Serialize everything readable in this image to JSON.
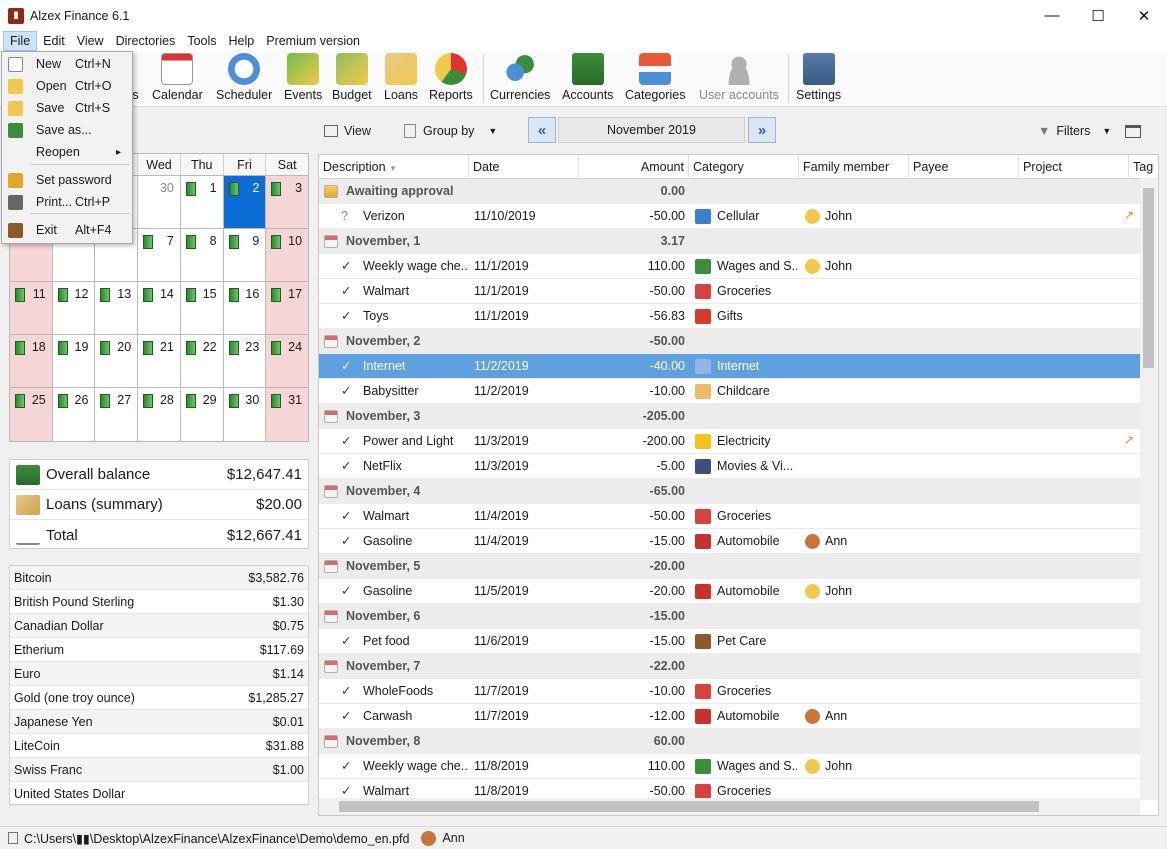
{
  "window": {
    "title": "Alzex Finance 6.1",
    "minimize": "—",
    "maximize": "☐",
    "close": "✕"
  },
  "menu": [
    "File",
    "Edit",
    "View",
    "Directories",
    "Tools",
    "Help",
    "Premium version"
  ],
  "file_menu": [
    {
      "label": "New",
      "shortcut": "Ctrl+N"
    },
    {
      "label": "Open",
      "shortcut": "Ctrl+O"
    },
    {
      "label": "Save",
      "shortcut": "Ctrl+S"
    },
    {
      "label": "Save as...",
      "shortcut": ""
    },
    {
      "label": "Reopen",
      "shortcut": "▸"
    },
    {
      "label": "Set password",
      "shortcut": ""
    },
    {
      "label": "Print...",
      "shortcut": "Ctrl+P"
    },
    {
      "label": "Exit",
      "shortcut": "Alt+F4"
    }
  ],
  "toolbar": [
    {
      "label": "ns",
      "icon": "transactions-icon"
    },
    {
      "label": "Calendar",
      "icon": "calendar-icon"
    },
    {
      "label": "Scheduler",
      "icon": "scheduler-icon"
    },
    {
      "label": "Events",
      "icon": "events-icon"
    },
    {
      "label": "Budget",
      "icon": "budget-icon"
    },
    {
      "label": "Loans",
      "icon": "loans-icon"
    },
    {
      "label": "Reports",
      "icon": "reports-icon"
    },
    {
      "label": "Currencies",
      "icon": "currencies-icon"
    },
    {
      "label": "Accounts",
      "icon": "accounts-icon"
    },
    {
      "label": "Categories",
      "icon": "categories-icon"
    },
    {
      "label": "User accounts",
      "icon": "user-accounts-icon",
      "disabled": true
    },
    {
      "label": "Settings",
      "icon": "settings-icon"
    }
  ],
  "list_toolbar": {
    "view": "View",
    "group_by": "Group by",
    "month": "November 2019",
    "filters": "Filters"
  },
  "calendar": {
    "weekdays": [
      "",
      "",
      "",
      "Wed",
      "Thu",
      "Fri",
      "Sat"
    ],
    "rows": [
      [
        {
          "d": ""
        },
        {
          "d": ""
        },
        {
          "d": ""
        },
        {
          "d": "30",
          "other": true
        },
        {
          "d": "1"
        },
        {
          "d": "2",
          "sel": true
        },
        {
          "d": "3",
          "we": true
        }
      ],
      [
        {
          "d": "",
          "we": true
        },
        {
          "d": ""
        },
        {
          "d": ""
        },
        {
          "d": "7"
        },
        {
          "d": "8"
        },
        {
          "d": "9"
        },
        {
          "d": "10",
          "we": true
        }
      ],
      [
        {
          "d": "11",
          "we": true
        },
        {
          "d": "12"
        },
        {
          "d": "13"
        },
        {
          "d": "14"
        },
        {
          "d": "15"
        },
        {
          "d": "16"
        },
        {
          "d": "17",
          "we": true
        }
      ],
      [
        {
          "d": "18",
          "we": true
        },
        {
          "d": "19"
        },
        {
          "d": "20"
        },
        {
          "d": "21"
        },
        {
          "d": "22"
        },
        {
          "d": "23"
        },
        {
          "d": "24",
          "we": true
        }
      ],
      [
        {
          "d": "25",
          "we": true
        },
        {
          "d": "26"
        },
        {
          "d": "27"
        },
        {
          "d": "28"
        },
        {
          "d": "29"
        },
        {
          "d": "30"
        },
        {
          "d": "31",
          "we": true
        }
      ]
    ]
  },
  "balance": [
    {
      "label": "Overall balance",
      "value": "$12,647.41"
    },
    {
      "label": "Loans (summary)",
      "value": "$20.00"
    },
    {
      "label": "Total",
      "value": "$12,667.41"
    }
  ],
  "rates": [
    {
      "name": "Bitcoin",
      "value": "$3,582.76"
    },
    {
      "name": "British Pound Sterling",
      "value": "$1.30"
    },
    {
      "name": "Canadian Dollar",
      "value": "$0.75"
    },
    {
      "name": "Etherium",
      "value": "$117.69"
    },
    {
      "name": "Euro",
      "value": "$1.14"
    },
    {
      "name": "Gold (one troy ounce)",
      "value": "$1,285.27"
    },
    {
      "name": "Japanese Yen",
      "value": "$0.01"
    },
    {
      "name": "LiteCoin",
      "value": "$31.88"
    },
    {
      "name": "Swiss Franc",
      "value": "$1.00"
    },
    {
      "name": "United States Dollar",
      "value": ""
    }
  ],
  "columns": [
    "Description",
    "Date",
    "Amount",
    "Category",
    "Family member",
    "Payee",
    "Project",
    "Tag"
  ],
  "rows": [
    {
      "type": "group",
      "label": "Awaiting approval",
      "amount": "0.00",
      "icon": "warning"
    },
    {
      "type": "tx",
      "check": "?",
      "desc": "Verizon",
      "date": "11/10/2019",
      "amount": "-50.00",
      "cat": "Cellular",
      "cat_color": "#3b7fd4",
      "fam": "John",
      "fam_color": "#f2c94c",
      "mark": true
    },
    {
      "type": "group",
      "label": "November, 1",
      "amount": "3.17"
    },
    {
      "type": "tx",
      "check": "✓",
      "desc": "Weekly wage che...",
      "date": "11/1/2019",
      "amount": "110.00",
      "cat": "Wages and S...",
      "cat_color": "#3a8d3a",
      "fam": "John",
      "fam_color": "#f2c94c"
    },
    {
      "type": "tx",
      "check": "✓",
      "desc": "Walmart",
      "date": "11/1/2019",
      "amount": "-50.00",
      "cat": "Groceries",
      "cat_color": "#d94040"
    },
    {
      "type": "tx",
      "check": "✓",
      "desc": "Toys",
      "date": "11/1/2019",
      "amount": "-56.83",
      "cat": "Gifts",
      "cat_color": "#d63a2a"
    },
    {
      "type": "group",
      "label": "November, 2",
      "amount": "-50.00"
    },
    {
      "type": "tx",
      "check": "✓",
      "desc": "Internet",
      "date": "11/2/2019",
      "amount": "-40.00",
      "cat": "Internet",
      "cat_color": "#8fb6e6",
      "sel": true
    },
    {
      "type": "tx",
      "check": "✓",
      "desc": "Babysitter",
      "date": "11/2/2019",
      "amount": "-10.00",
      "cat": "Childcare",
      "cat_color": "#f0b86a"
    },
    {
      "type": "group",
      "label": "November, 3",
      "amount": "-205.00"
    },
    {
      "type": "tx",
      "check": "✓",
      "desc": "Power and Light",
      "date": "11/3/2019",
      "amount": "-200.00",
      "cat": "Electricity",
      "cat_color": "#f6c31c",
      "mark": true
    },
    {
      "type": "tx",
      "check": "✓",
      "desc": "NetFlix",
      "date": "11/3/2019",
      "amount": "-5.00",
      "cat": "Movies & Vi...",
      "cat_color": "#3d4f7a"
    },
    {
      "type": "group",
      "label": "November, 4",
      "amount": "-65.00"
    },
    {
      "type": "tx",
      "check": "✓",
      "desc": "Walmart",
      "date": "11/4/2019",
      "amount": "-50.00",
      "cat": "Groceries",
      "cat_color": "#d94040"
    },
    {
      "type": "tx",
      "check": "✓",
      "desc": "Gasoline",
      "date": "11/4/2019",
      "amount": "-15.00",
      "cat": "Automobile",
      "cat_color": "#c8322a",
      "fam": "Ann",
      "fam_color": "#c8743a"
    },
    {
      "type": "group",
      "label": "November, 5",
      "amount": "-20.00"
    },
    {
      "type": "tx",
      "check": "✓",
      "desc": "Gasoline",
      "date": "11/5/2019",
      "amount": "-20.00",
      "cat": "Automobile",
      "cat_color": "#c8322a",
      "fam": "John",
      "fam_color": "#f2c94c"
    },
    {
      "type": "group",
      "label": "November, 6",
      "amount": "-15.00"
    },
    {
      "type": "tx",
      "check": "✓",
      "desc": "Pet food",
      "date": "11/6/2019",
      "amount": "-15.00",
      "cat": "Pet Care",
      "cat_color": "#8a5a2a"
    },
    {
      "type": "group",
      "label": "November, 7",
      "amount": "-22.00"
    },
    {
      "type": "tx",
      "check": "✓",
      "desc": "WholeFoods",
      "date": "11/7/2019",
      "amount": "-10.00",
      "cat": "Groceries",
      "cat_color": "#d94040"
    },
    {
      "type": "tx",
      "check": "✓",
      "desc": "Carwash",
      "date": "11/7/2019",
      "amount": "-12.00",
      "cat": "Automobile",
      "cat_color": "#c8322a",
      "fam": "Ann",
      "fam_color": "#c8743a"
    },
    {
      "type": "group",
      "label": "November, 8",
      "amount": "60.00"
    },
    {
      "type": "tx",
      "check": "✓",
      "desc": "Weekly wage che...",
      "date": "11/8/2019",
      "amount": "110.00",
      "cat": "Wages and S...",
      "cat_color": "#3a8d3a",
      "fam": "John",
      "fam_color": "#f2c94c"
    },
    {
      "type": "tx",
      "check": "✓",
      "desc": "Walmart",
      "date": "11/8/2019",
      "amount": "-50.00",
      "cat": "Groceries",
      "cat_color": "#d94040"
    }
  ],
  "status": {
    "path": "C:\\Users\\▮▮\\Desktop\\AlzexFinance\\AlzexFinance\\Demo\\demo_en.pfd",
    "user": "Ann"
  }
}
